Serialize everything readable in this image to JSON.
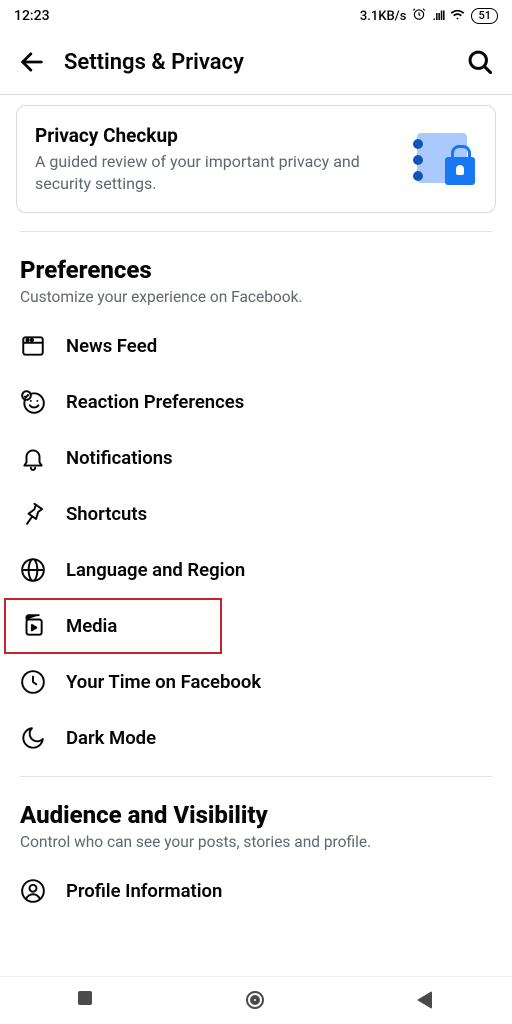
{
  "status": {
    "time": "12:23",
    "net_speed": "3.1KB/s",
    "battery": "51"
  },
  "header": {
    "title": "Settings & Privacy"
  },
  "card": {
    "title": "Privacy Checkup",
    "subtitle": "A guided review of your important privacy and security settings."
  },
  "preferences": {
    "title": "Preferences",
    "subtitle": "Customize your experience on Facebook.",
    "items": [
      {
        "label": "News Feed"
      },
      {
        "label": "Reaction Preferences"
      },
      {
        "label": "Notifications"
      },
      {
        "label": "Shortcuts"
      },
      {
        "label": "Language and Region"
      },
      {
        "label": "Media"
      },
      {
        "label": "Your Time on Facebook"
      },
      {
        "label": "Dark Mode"
      }
    ]
  },
  "audience": {
    "title": "Audience and Visibility",
    "subtitle": "Control who can see your posts, stories and profile.",
    "items": [
      {
        "label": "Profile Information"
      }
    ]
  }
}
